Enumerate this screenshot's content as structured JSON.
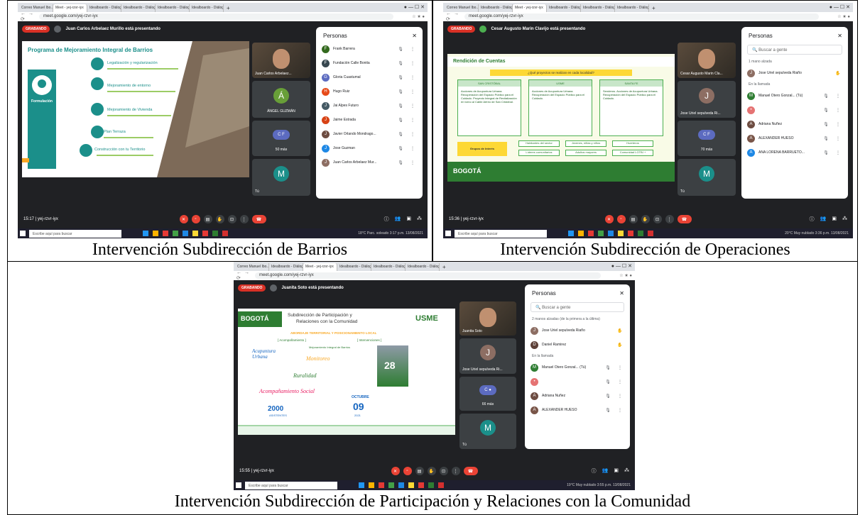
{
  "captions": {
    "c1": "Intervención Subdirección de Barrios",
    "c2": "Intervención Subdirección de Operaciones",
    "c3": "Intervención Subdirección de Participación y Relaciones con la Comunidad"
  },
  "common": {
    "tab_gmail": "Correo Manuel Ibo...",
    "tab_meet": "Meet - yej-rzvr-iyx",
    "tab_ideal": "Idealboardo - Diálogo",
    "tab_ideal2": "Idealboardo - Diálogo",
    "tab_ideal3": "Idealboardo - Diálogo",
    "tab_ideal4": "Idealboardo - Diálogo",
    "tab_plus": "+",
    "win_ctrl": "●  —  ☐  ✕",
    "url": "meet.google.com/yej-rzvr-iyx",
    "rec": "GRABANDO",
    "meeting_code": "yej-rzvr-iyx",
    "people_title": "Personas",
    "close": "✕",
    "search_placeholder": "Buscar a gente",
    "tu": "Tú",
    "task_search": "Escribe aquí para buscar"
  },
  "s1": {
    "presenter": "Juan Carlos Arbelaez Murillo está presentando",
    "slide_title": "Programa de Mejoramiento Integral de Barrios",
    "formulacion": "Formulación",
    "items": [
      "Legalización y regularización",
      "Mejoramiento de entorno",
      "Mejoramiento de Vivienda",
      "Plan Terraza",
      "Construcción con tu Territorio"
    ],
    "cam_label": "Juan Carlos Arbelaez...",
    "tile2_letter": "Á",
    "tile2_name": "ÁNGEL GUZMÁN",
    "tile3_more": "50 más",
    "tile4_letter": "M",
    "time": "15:17",
    "people": [
      {
        "n": "Frank Barrera",
        "c": "#33691e",
        "l": "F"
      },
      {
        "n": "Fundación Calle Bonita",
        "c": "#37474f",
        "l": "F"
      },
      {
        "n": "Gloria Cuastumal",
        "c": "#5c6bc0",
        "l": "G"
      },
      {
        "n": "Hugo Ruiz",
        "c": "#e64a19",
        "l": "H"
      },
      {
        "n": "Jai Alpes Futuro",
        "c": "#455a64",
        "l": "J"
      },
      {
        "n": "Jaime Estrada",
        "c": "#d84315",
        "l": "J"
      },
      {
        "n": "Javier Orlando Mondrago...",
        "c": "#6d4c41",
        "l": "J"
      },
      {
        "n": "Jose Guzman",
        "c": "#1e88e5",
        "l": "J"
      },
      {
        "n": "Juan Carlos Arbelaez Mur...",
        "c": "#8d6e63",
        "l": "J"
      }
    ],
    "tray": "18°C  Parc. soleado   3:17 p.m. 13/08/2021"
  },
  "s2": {
    "presenter": "Cesar Augusto Marin Clavijo está presentando",
    "slide_title": "Rendición de Cuentas",
    "question": "¿Qué proyectos se realizan en cada localidad?",
    "cols": [
      "SAN CRISTÓBAL",
      "USME",
      "SANTA FE"
    ],
    "col_body": [
      "Acciones de Acupuntura Urbana. Recuperación del Espacio Público para el Cuidado. Proyecto Integral de Revitalización en torno al Cable Aéreo de San Cristóbal.",
      "Acciones de Acupuntura Urbana. Recuperación del Espacio Público para el Cuidado.",
      "Senderos. Acciones de Acupuntura Urbana. Recuperación del Espacio Público para el Cuidado."
    ],
    "grupos": "Grupos de Interés",
    "chips": [
      "Habitantes del sector",
      "Jóvenes, niñas y niños",
      "Huerteros",
      "Líderes comunitarios",
      "Adultos mayores",
      "Comunidad LGTBI +"
    ],
    "bogota": "BOGOTÁ",
    "cam_label": "Cesar Augusto Marin Cla...",
    "tile2_letter": "J",
    "tile2_name": "Jose Uriel sepulveda Ri...",
    "tile3_more": "70 más",
    "tile4_letter": "M",
    "time": "15:36",
    "hands": "1 mano alzada",
    "in_call": "En la llamada",
    "people_raised": [
      {
        "n": "Jose Uriel sepulveda Riaño",
        "c": "#8d6e63",
        "l": "J"
      }
    ],
    "people": [
      {
        "n": "Manuel Otero Gonzal... (Tú)",
        "c": "#2e7d32",
        "l": "M"
      },
      {
        "n": "",
        "c": "#e57373",
        "l": "•"
      },
      {
        "n": "Adriana Nuñez",
        "c": "#6d4c41",
        "l": "A"
      },
      {
        "n": "ALEXANDER HUESO",
        "c": "#795548",
        "l": "A"
      },
      {
        "n": "ANA LORENA BARRUETO...",
        "c": "#1e88e5",
        "l": "A"
      }
    ],
    "tray": "20°C  Muy nublado   3:36 p.m. 13/08/2021"
  },
  "s3": {
    "presenter": "Juanita Soto está presentando",
    "title1": "Subdirección de Participación y",
    "title2": "Relaciones con la Comunidad",
    "usme": "USME",
    "bogota": "BOGOTÁ",
    "abordaje": "ABORDAJE TERRITORIAL Y POSICIONAMIENTO LOCAL",
    "acomp": "[ Acompañamiento ]",
    "interv": "[ Intervenciones ]",
    "words": [
      "Acupuntura Urbana",
      "Monitoreo",
      "Mejoramiento Integral de Barrios",
      "Ruralidad",
      "Acompañamiento Social"
    ],
    "big_num": "2000",
    "big_num_label": "ASISTENTES",
    "date_month": "OCTUBRE",
    "date_day": "09",
    "date_year": "2021",
    "poster_num": "28",
    "cam_label": "Juanita Soto",
    "tile2_letter": "J",
    "tile2_name": "Jose Uriel sepulveda Ri...",
    "tile3_more": "66 más",
    "tile4_letter": "M",
    "time": "15:55",
    "hands": "2 manos alzadas (de la primera a la última)",
    "in_call": "En la llamada",
    "people_raised": [
      {
        "n": "Jose Uriel sepulveda Riaño",
        "c": "#8d6e63",
        "l": "J"
      },
      {
        "n": "Daniel Ramirez",
        "c": "#5d4037",
        "l": "D"
      }
    ],
    "people": [
      {
        "n": "Manuel Otero Gonzal... (Tú)",
        "c": "#2e7d32",
        "l": "M"
      },
      {
        "n": "",
        "c": "#e57373",
        "l": "•"
      },
      {
        "n": "Adriana Nuñez",
        "c": "#6d4c41",
        "l": "A"
      },
      {
        "n": "ALEXANDER HUESO",
        "c": "#795548",
        "l": "A"
      }
    ],
    "tray": "19°C  Muy nublado   3:55 p.m. 13/08/2021"
  }
}
